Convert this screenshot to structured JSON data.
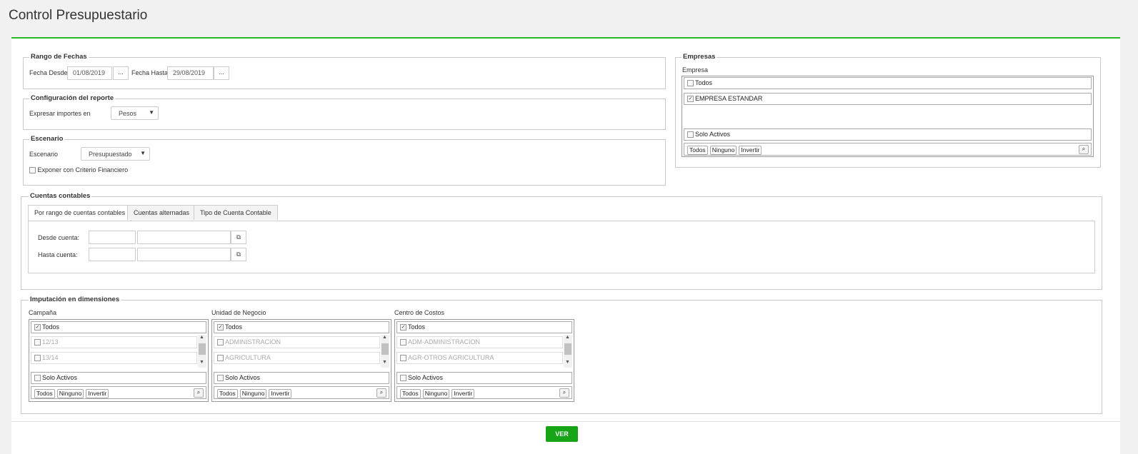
{
  "page": {
    "title": "Control Presupuestario"
  },
  "rango": {
    "legend": "Rango de Fechas",
    "desde_label": "Fecha Desde",
    "desde_value": "01/08/2019",
    "hasta_label": "Fecha Hasta",
    "hasta_value": "29/08/2019",
    "dots": "..."
  },
  "config": {
    "legend": "Configuración del reporte",
    "label": "Expresar importes en",
    "value": "Pesos"
  },
  "escenario": {
    "legend": "Escenario",
    "label": "Escenario",
    "value": "Presupuestado",
    "checkbox_label": "Exponer con Criterio Financiero"
  },
  "empresas": {
    "legend": "Empresas",
    "label": "Empresa",
    "todos": "Todos",
    "item": "EMPRESA ESTANDAR",
    "solo_activos": "Solo Activos",
    "btn_todos": "Todos",
    "btn_ninguno": "Ninguno",
    "btn_invertir": "Invertir"
  },
  "cuentas": {
    "legend": "Cuentas contables",
    "tabs": [
      "Por rango de cuentas contables",
      "Cuentas alternadas",
      "Tipo de Cuenta Contable"
    ],
    "desde_label": "Desde cuenta:",
    "hasta_label": "Hasta cuenta:"
  },
  "imputacion": {
    "legend": "Imputación en dimensiones",
    "lists": [
      {
        "title": "Campaña",
        "todos": "Todos",
        "items": [
          "12/13",
          "13/14"
        ],
        "solo_activos": "Solo Activos"
      },
      {
        "title": "Unidad de Negocio",
        "todos": "Todos",
        "items": [
          "ADMINISTRACION",
          "AGRICULTURA"
        ],
        "solo_activos": "Solo Activos"
      },
      {
        "title": "Centro de Costos",
        "todos": "Todos",
        "items": [
          "ADM-ADMINISTRACION",
          "AGR-OTROS AGRICULTURA"
        ],
        "solo_activos": "Solo Activos"
      }
    ],
    "btn_todos": "Todos",
    "btn_ninguno": "Ninguno",
    "btn_invertir": "Invertir"
  },
  "actions": {
    "ver": "VER"
  },
  "colors": {
    "accent": "#2bb52b",
    "button": "#17a417"
  }
}
